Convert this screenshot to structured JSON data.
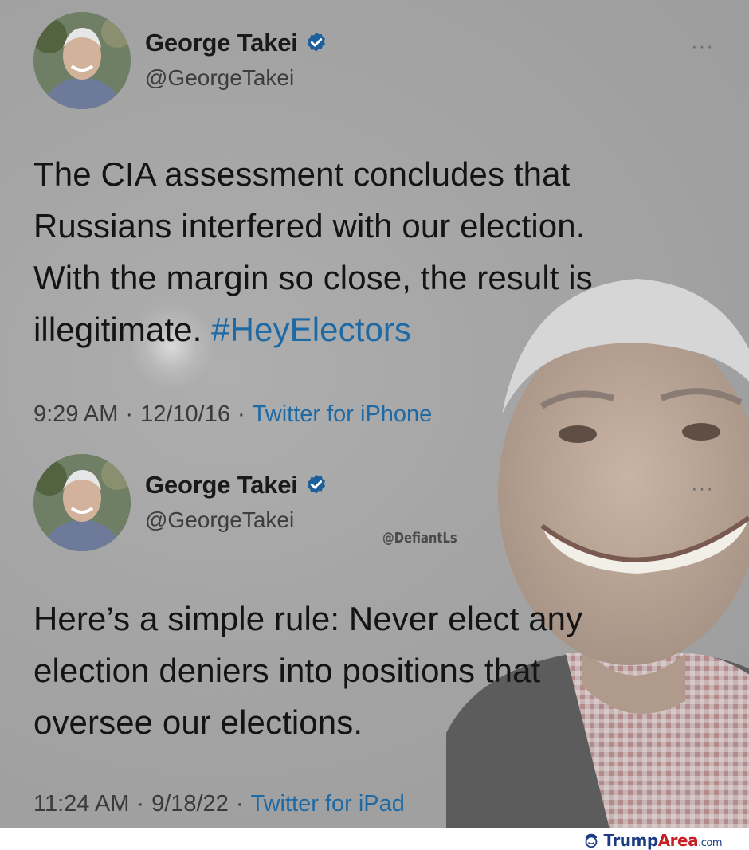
{
  "tweets": [
    {
      "display_name": "George Takei",
      "handle": "@GeorgeTakei",
      "text": "The CIA assessment concludes that\nRussians interfered with our election.\nWith the margin so close, the result is\nillegitimate. ",
      "hashtag": "#HeyElectors",
      "time": "9:29 AM",
      "date": "12/10/16",
      "source": "Twitter for iPhone",
      "more": "···"
    },
    {
      "display_name": "George Takei",
      "handle": "@GeorgeTakei",
      "text": "Here’s a simple rule: Never elect any\nelection deniers into positions that\noversee our elections.",
      "time": "11:24 AM",
      "date": "9/18/22",
      "source": "Twitter for iPad",
      "more": "···"
    }
  ],
  "separator": "·",
  "watermark": "@DefiantLs",
  "brand": {
    "part1": "Trump",
    "part2": "Area",
    "tld": ".com",
    "color_primary": "#1b3c84",
    "color_accent": "#c62026"
  },
  "colors": {
    "link": "#1e6aa5",
    "background": "#a4a4a4",
    "verified": "#1d9bf0"
  },
  "icons": [
    "avatar-photo",
    "verified-badge-icon",
    "more-options-icon",
    "trumparea-logo-icon"
  ]
}
